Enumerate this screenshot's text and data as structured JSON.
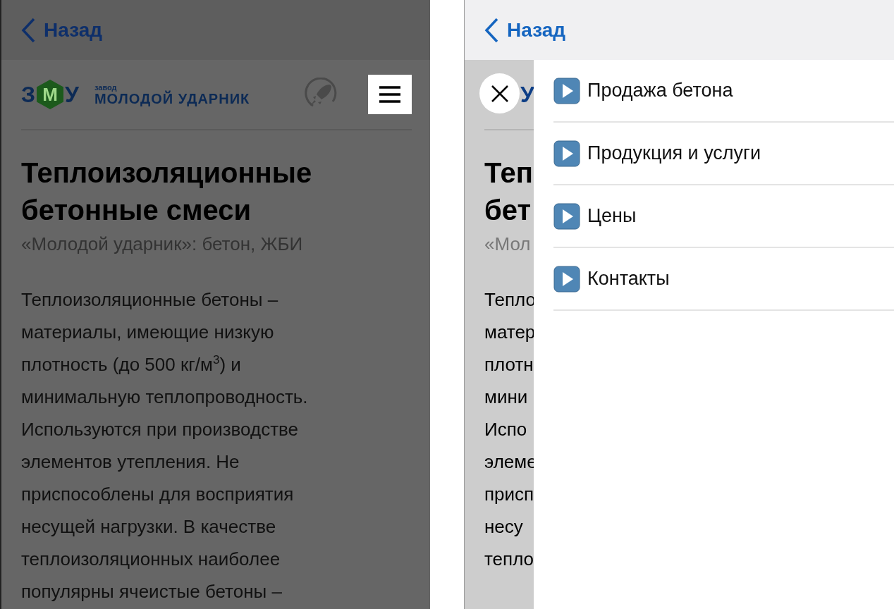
{
  "left_screen": {
    "menu_open": false,
    "nav": {
      "back": "Назад"
    },
    "logo": {
      "letters": [
        "З",
        "М",
        "У"
      ],
      "small": "завод",
      "name": "МОЛОДОЙ УДАРНИК"
    },
    "page": {
      "title": "Теплоизоляционные\nбетонные смеси",
      "subtitle": "«Молодой ударник»: бетон, ЖБИ",
      "body": "Теплоизоляционные бетоны –\nматериалы, имеющие низкую\nплотность (до 500 кг/м$^{3}$) и\nминимальную теплопроводность.\nИспользуются при производстве\nэлементов утепления. Не\nприспособлены для восприятия\nнесущей нагрузки. В качестве\nтеплоизоляционных наиболее\nпопулярны ячеистые бетоны –"
    }
  },
  "right_screen": {
    "menu_open": true,
    "nav": {
      "back": "Назад"
    },
    "logo": {
      "letters": [
        "У"
      ]
    },
    "page": {
      "title": "Теп\nбет",
      "subtitle": "«Мол",
      "body": "Тепло\nматер\nплотн\nмини\nИспо\nэлеме\nприсп\nнесу\nтепло"
    },
    "menu_items": [
      {
        "label": "Продажа бетона"
      },
      {
        "label": "Продукция и услуги"
      },
      {
        "label": "Цены"
      },
      {
        "label": "Контакты"
      }
    ]
  }
}
